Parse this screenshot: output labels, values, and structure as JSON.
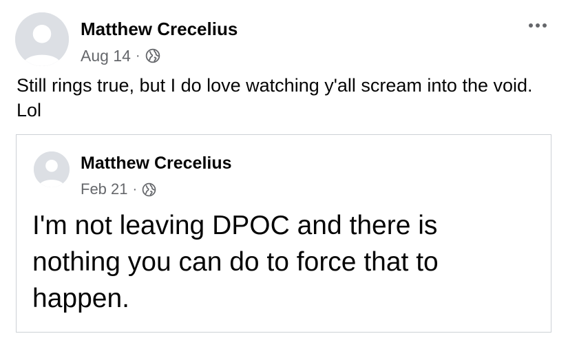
{
  "post": {
    "author": "Matthew Crecelius",
    "date": "Aug 14",
    "separator": "·",
    "audience_icon": "globe-icon",
    "more_icon": "more-options-icon",
    "text": "Still rings true, but I do love watching y'all scream into the void. Lol"
  },
  "shared_post": {
    "author": "Matthew Crecelius",
    "date": "Feb 21",
    "separator": "·",
    "audience_icon": "globe-icon",
    "text": "I'm not leaving DPOC and there is nothing you can do to force that to happen."
  },
  "colors": {
    "text_primary": "#050505",
    "text_secondary": "#65676b",
    "avatar_bg": "#dcdfe4",
    "card_border": "#ccd0d5"
  }
}
